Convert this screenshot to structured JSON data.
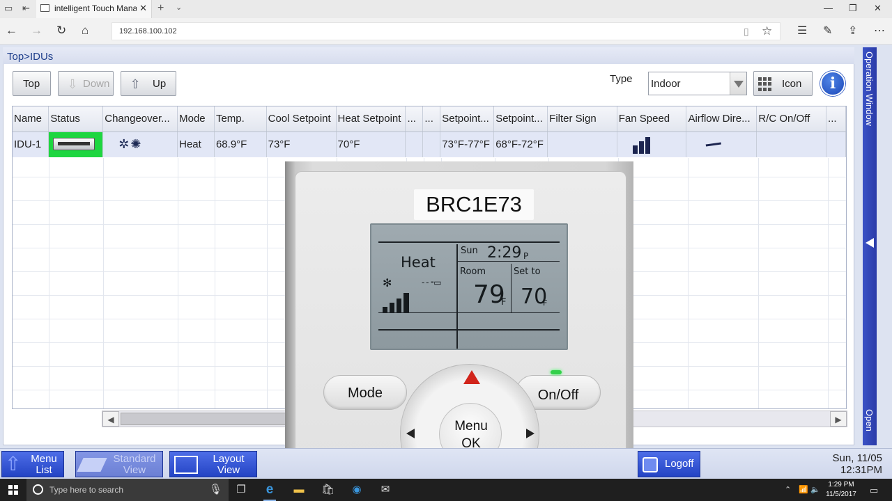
{
  "browser": {
    "tab_title": "intelligent Touch Manag",
    "url": "192.168.100.102"
  },
  "app": {
    "breadcrumb": "Top>IDUs",
    "toolbar": {
      "top_label": "Top",
      "down_label": "Down",
      "up_label": "Up",
      "type_label": "Type",
      "type_value": "Indoor",
      "icon_label": "Icon",
      "info_label": "i"
    },
    "table": {
      "columns": [
        "Name",
        "Status",
        "Changeover...",
        "Mode",
        "Temp.",
        "Cool Setpoint",
        "Heat Setpoint",
        "...",
        "...",
        "Setpoint...",
        "Setpoint...",
        "Filter Sign",
        "Fan Speed",
        "Airflow Dire...",
        "R/C On/Off",
        "..."
      ],
      "rows": [
        {
          "name": "IDU-1",
          "status": "",
          "changeover": "",
          "mode": "Heat",
          "temp": "68.9°F",
          "cool_setpoint": "73°F",
          "heat_setpoint": "70°F",
          "col8": "",
          "col9": "",
          "setpoint_cool_range": "73°F-77°F",
          "setpoint_heat_range": "68°F-72°F",
          "filter_sign": "",
          "fan_speed_level": 3,
          "airflow": "",
          "rc_onoff": "",
          "col16": ""
        }
      ]
    },
    "side_panel": {
      "title": "Operation Window",
      "open_label": "Open"
    },
    "bottom": {
      "menu_list": [
        "Menu",
        "List"
      ],
      "standard_view": [
        "Standard",
        "View"
      ],
      "layout_view": [
        "Layout",
        "View"
      ],
      "logoff": "Logoff",
      "date": "Sun, 11/05",
      "time": "12:31PM"
    }
  },
  "remote": {
    "model": "BRC1E73",
    "mode_text": "Heat",
    "day": "Sun",
    "clock": "2:29",
    "clock_suffix": "P",
    "room_label": "Room",
    "room_temp": "79",
    "set_label": "Set to",
    "set_temp": "70",
    "unit": "F",
    "mode_button": "Mode",
    "onoff_button": "On/Off",
    "menu_label": "Menu",
    "ok_label": "OK"
  },
  "taskbar": {
    "search_placeholder": "Type here to search",
    "time": "1:29 PM",
    "date": "11/5/2017"
  },
  "colors": {
    "status_on": "#1ed640",
    "selected_row": "#e2e7f6",
    "panel_blue": "#2a3ba8",
    "alert_red": "#d1241b"
  }
}
